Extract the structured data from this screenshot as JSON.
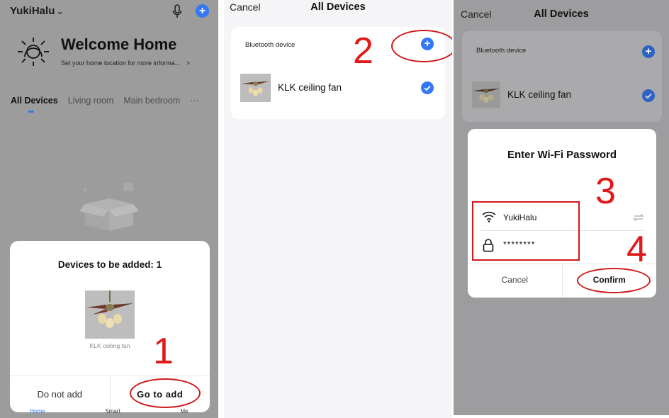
{
  "panel1": {
    "home_name": "YukiHalu",
    "chevron": "⌄",
    "welcome_title": "Welcome Home",
    "welcome_sub": "Set your home location for more informa...",
    "welcome_chevron": ">",
    "tabs": [
      "All Devices",
      "Living room",
      "Main bedroom",
      "···"
    ],
    "sheet_title": "Devices to be added: 1",
    "device_label": "KLK ceiling fan",
    "btn_cancel": "Do not add",
    "btn_add": "Go to add",
    "nav": [
      "Home",
      "Smart",
      "Me"
    ],
    "step": "1"
  },
  "panel2": {
    "cancel": "Cancel",
    "title": "All Devices",
    "section": "Bluetooth device",
    "device": "KLK ceiling fan",
    "step": "2"
  },
  "panel3": {
    "cancel": "Cancel",
    "title": "All Devices",
    "section": "Bluetooth device",
    "device": "KLK ceiling fan",
    "dialog_title": "Enter Wi-Fi Password",
    "wifi_name": "YukiHalu",
    "password": "********",
    "btn_cancel": "Cancel",
    "btn_confirm": "Confirm",
    "step3": "3",
    "step4": "4"
  },
  "colors": {
    "accent": "#3478f6",
    "annotation": "#e01919"
  },
  "icons": [
    "chevron-down-icon",
    "microphone-icon",
    "plus-icon",
    "sun-icon",
    "box-icon",
    "wifi-icon",
    "lock-icon",
    "check-icon",
    "switch-network-icon"
  ]
}
